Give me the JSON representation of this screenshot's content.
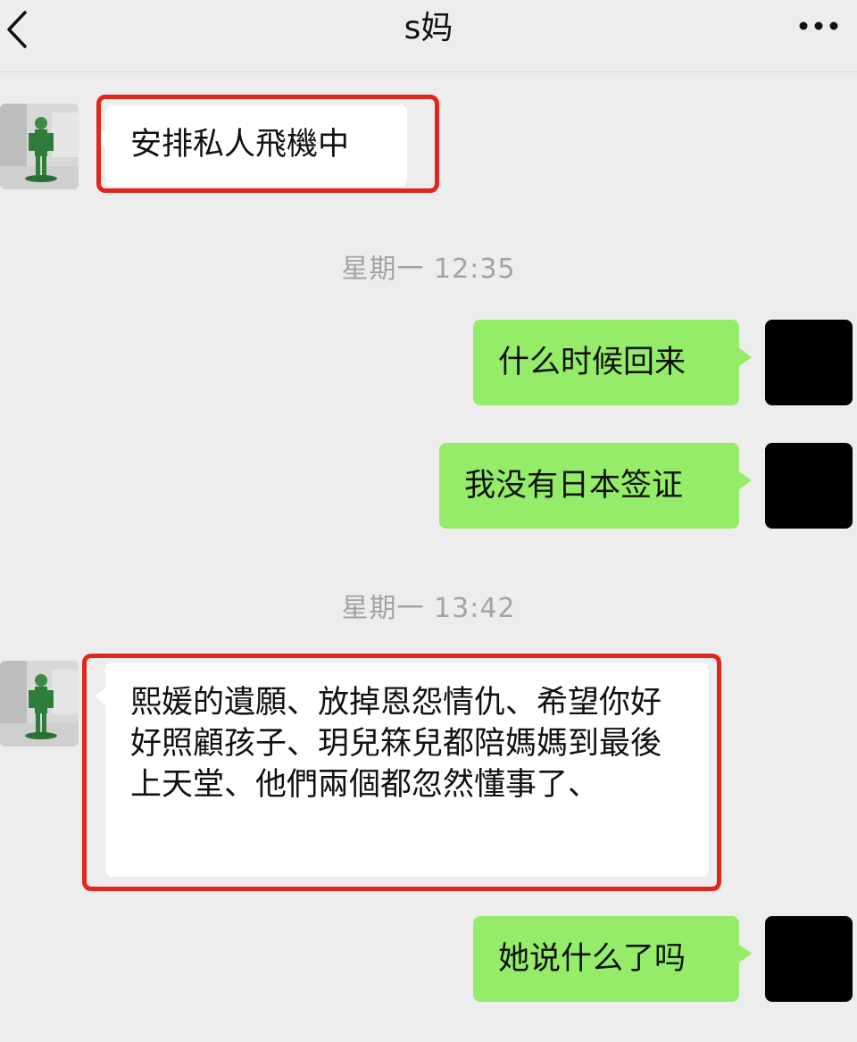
{
  "header": {
    "title": "s妈"
  },
  "messages": [
    {
      "text": "安排私人飛機中"
    },
    {
      "text": "什么时候回来"
    },
    {
      "text": "我没有日本签证"
    },
    {
      "text": "熙媛的遺願、放掉恩怨情仇、希望你好好照顧孩子、玥兒箖兒都陪媽媽到最後上天堂、他們兩個都忽然懂事了、"
    },
    {
      "text": "她说什么了吗"
    }
  ],
  "timestamps": [
    "星期一 12:35",
    "星期一 13:42"
  ],
  "colors": {
    "out_bubble": "#95ec69",
    "in_bubble": "#ffffff",
    "highlight": "#e0271d",
    "background": "#ededed"
  },
  "icons": [
    "back-chevron-icon",
    "more-dots-icon"
  ]
}
